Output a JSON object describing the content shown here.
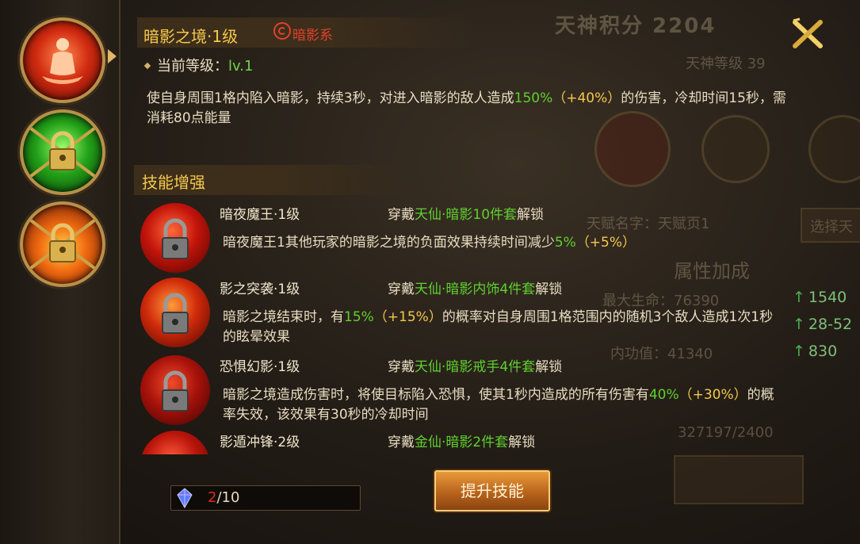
{
  "background": {
    "title": "天神积分 2204",
    "level": "天神等级 39",
    "talent_name": "天赋名字：天赋页1",
    "select_button": "选择天",
    "attr_title": "属性加成",
    "max_hp": "最大生命：76390",
    "internal": "内功值：41340",
    "exp": "327197/2400",
    "rail_values": [
      "1540",
      "28-52",
      "830"
    ]
  },
  "tabs": [
    {
      "name": "shadow-realm-tab",
      "selected": true
    },
    {
      "name": "green-locked-tab",
      "locked": true
    },
    {
      "name": "fire-locked-tab",
      "locked": true
    }
  ],
  "skill": {
    "title": "暗影之境·1级",
    "school": "暗影系",
    "current_level_label": "当前等级：",
    "current_level_value": "lv.1",
    "desc": {
      "p1": "使自身周围1格内陷入暗影，持续3秒，对进入暗影的敌人造成",
      "v1": "150%",
      "b1": "（+40%）",
      "p2": "的伤害，冷却时间15秒，需消耗80点能量"
    }
  },
  "enhance_title": "技能增强",
  "enhancements": [
    {
      "name": "暗夜魔王·1级",
      "req_prefix": "穿戴",
      "req_set": "天仙·暗影10件套",
      "req_suffix": "解锁",
      "d1": "暗夜魔王1其他玩家的暗影之境的负面效果持续时间减少",
      "v": "5%",
      "b": "（+5%）",
      "d2": ""
    },
    {
      "name": "影之突袭·1级",
      "req_prefix": "穿戴",
      "req_set": "天仙·暗影内饰4件套",
      "req_suffix": "解锁",
      "d1": "暗影之境结束时，有",
      "v": "15%",
      "b": "（+15%）",
      "d2": "的概率对自身周围1格范围内的随机3个敌人造成1次1秒的眩晕效果"
    },
    {
      "name": "恐惧幻影·1级",
      "req_prefix": "穿戴",
      "req_set": "天仙·暗影戒手4件套",
      "req_suffix": "解锁",
      "d1": "暗影之境造成伤害时，将使目标陷入恐惧，使其1秒内造成的所有伤害有",
      "v": "40%",
      "b": "（+30%）",
      "d2": "的概率失效，该效果有30秒的冷却时间"
    },
    {
      "name": "影遁冲锋·2级",
      "req_prefix": "穿戴",
      "req_set": "金仙·暗影2件套",
      "req_suffix": "解锁",
      "d1": "",
      "v": "",
      "b": "",
      "d2": ""
    }
  ],
  "points": {
    "current": "2",
    "sep": "/",
    "max": "10"
  },
  "upgrade_button": "提升技能",
  "colors": {
    "gold": "#f5c84c",
    "green": "#5fd02f",
    "red": "#e02a1e",
    "text": "#e8dcc0"
  }
}
